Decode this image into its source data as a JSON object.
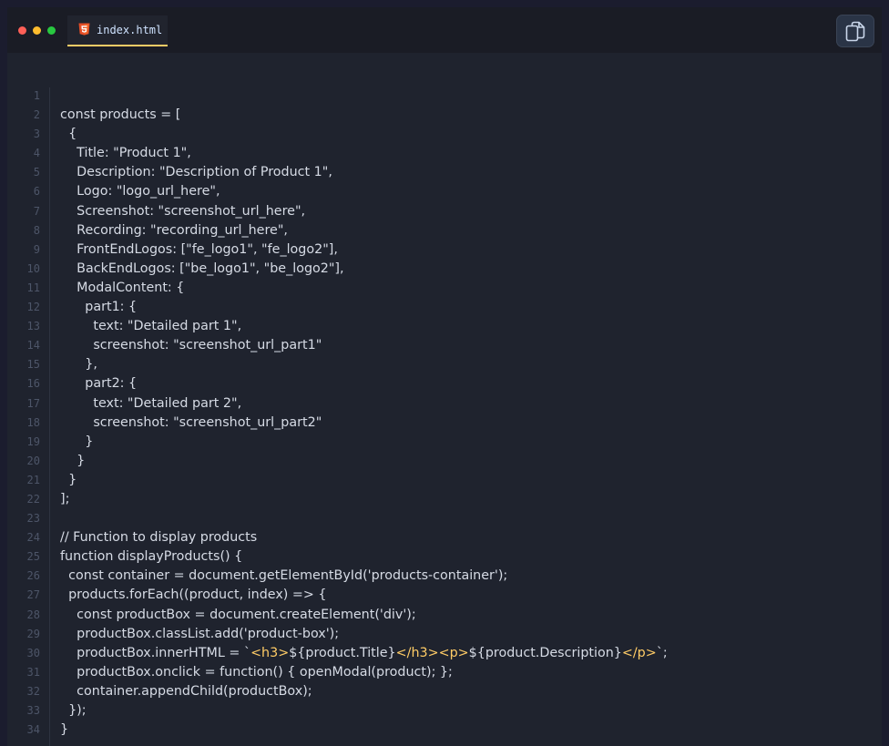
{
  "window": {
    "tab": {
      "filename": "index.html",
      "icon": "html5-icon"
    },
    "copy_button": {
      "icon": "copy-icon"
    }
  },
  "colors": {
    "accent_tab_underline": "#ffcc66",
    "template_tag": "#ffcc66",
    "code_text": "#d6dbe5",
    "line_number": "#4d5568"
  },
  "code": {
    "lines": [
      {
        "n": "1",
        "parts": [
          {
            "t": ""
          }
        ]
      },
      {
        "n": "2",
        "parts": [
          {
            "t": "const products = ["
          }
        ]
      },
      {
        "n": "3",
        "parts": [
          {
            "t": "  {"
          }
        ]
      },
      {
        "n": "4",
        "parts": [
          {
            "t": "    Title: \"Product 1\","
          }
        ]
      },
      {
        "n": "5",
        "parts": [
          {
            "t": "    Description: \"Description of Product 1\","
          }
        ]
      },
      {
        "n": "6",
        "parts": [
          {
            "t": "    Logo: \"logo_url_here\","
          }
        ]
      },
      {
        "n": "7",
        "parts": [
          {
            "t": "    Screenshot: \"screenshot_url_here\","
          }
        ]
      },
      {
        "n": "8",
        "parts": [
          {
            "t": "    Recording: \"recording_url_here\","
          }
        ]
      },
      {
        "n": "9",
        "parts": [
          {
            "t": "    FrontEndLogos: [\"fe_logo1\", \"fe_logo2\"],"
          }
        ]
      },
      {
        "n": "10",
        "parts": [
          {
            "t": "    BackEndLogos: [\"be_logo1\", \"be_logo2\"],"
          }
        ]
      },
      {
        "n": "11",
        "parts": [
          {
            "t": "    ModalContent: {"
          }
        ]
      },
      {
        "n": "12",
        "parts": [
          {
            "t": "      part1: {"
          }
        ]
      },
      {
        "n": "13",
        "parts": [
          {
            "t": "        text: \"Detailed part 1\","
          }
        ]
      },
      {
        "n": "14",
        "parts": [
          {
            "t": "        screenshot: \"screenshot_url_part1\""
          }
        ]
      },
      {
        "n": "15",
        "parts": [
          {
            "t": "      },"
          }
        ]
      },
      {
        "n": "16",
        "parts": [
          {
            "t": "      part2: {"
          }
        ]
      },
      {
        "n": "17",
        "parts": [
          {
            "t": "        text: \"Detailed part 2\","
          }
        ]
      },
      {
        "n": "18",
        "parts": [
          {
            "t": "        screenshot: \"screenshot_url_part2\""
          }
        ]
      },
      {
        "n": "19",
        "parts": [
          {
            "t": "      }"
          }
        ]
      },
      {
        "n": "20",
        "parts": [
          {
            "t": "    }"
          }
        ]
      },
      {
        "n": "21",
        "parts": [
          {
            "t": "  }"
          }
        ]
      },
      {
        "n": "22",
        "parts": [
          {
            "t": "];"
          }
        ]
      },
      {
        "n": "23",
        "parts": [
          {
            "t": ""
          }
        ]
      },
      {
        "n": "24",
        "parts": [
          {
            "t": "// Function to display products"
          }
        ]
      },
      {
        "n": "25",
        "parts": [
          {
            "t": "function displayProducts() {"
          }
        ]
      },
      {
        "n": "26",
        "parts": [
          {
            "t": "  const container = document.getElementById('products-container');"
          }
        ]
      },
      {
        "n": "27",
        "parts": [
          {
            "t": "  products.forEach((product, index) => {"
          }
        ]
      },
      {
        "n": "28",
        "parts": [
          {
            "t": "    const productBox = document.createElement('div');"
          }
        ]
      },
      {
        "n": "29",
        "parts": [
          {
            "t": "    productBox.classList.add('product-box');"
          }
        ]
      },
      {
        "n": "30",
        "parts": [
          {
            "t": "    productBox.innerHTML = `"
          },
          {
            "t": "<h3>",
            "tag": true
          },
          {
            "t": "${product.Title}"
          },
          {
            "t": "</h3><p>",
            "tag": true
          },
          {
            "t": "${product.Description}"
          },
          {
            "t": "</p>",
            "tag": true
          },
          {
            "t": "`;"
          }
        ]
      },
      {
        "n": "31",
        "parts": [
          {
            "t": "    productBox.onclick = function() { openModal(product); };"
          }
        ]
      },
      {
        "n": "32",
        "parts": [
          {
            "t": "    container.appendChild(productBox);"
          }
        ]
      },
      {
        "n": "33",
        "parts": [
          {
            "t": "  });"
          }
        ]
      },
      {
        "n": "34",
        "parts": [
          {
            "t": "}"
          }
        ]
      }
    ]
  }
}
